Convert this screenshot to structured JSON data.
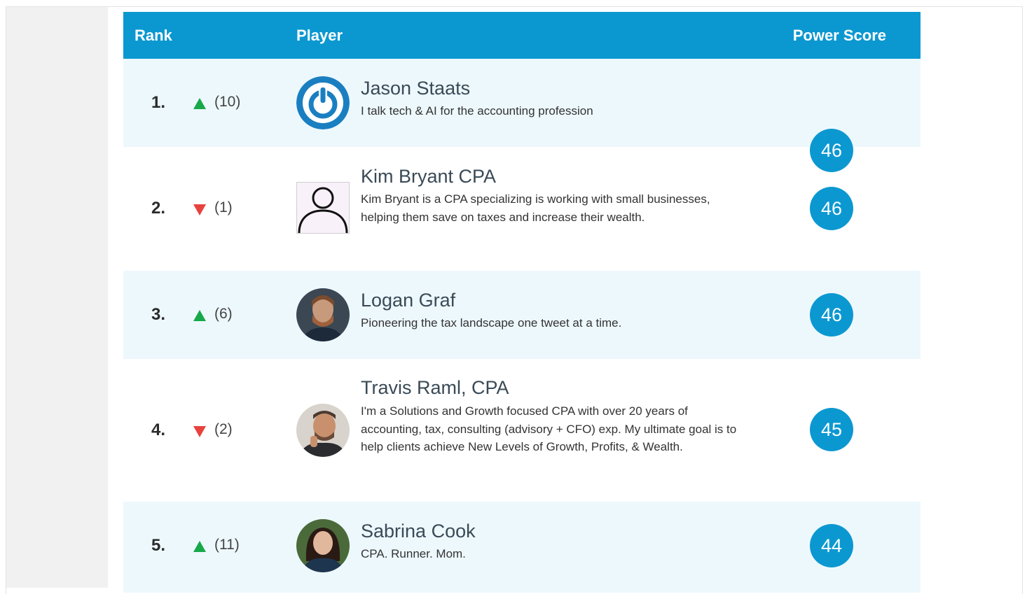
{
  "header": {
    "rank_label": "Rank",
    "player_label": "Player",
    "score_label": "Power Score"
  },
  "players": [
    {
      "rank": "1.",
      "trend": "up",
      "change": "(10)",
      "name": "Jason Staats",
      "bio": "I talk tech & AI for the accounting profession",
      "score": "46",
      "avatar": "power-logo-avatar"
    },
    {
      "rank": "2.",
      "trend": "down",
      "change": "(1)",
      "name": "Kim Bryant CPA",
      "bio": "Kim Bryant is a CPA specializing is working with small businesses, helping them save on taxes and increase their wealth.",
      "score": "46",
      "avatar": "default-person-avatar"
    },
    {
      "rank": "3.",
      "trend": "up",
      "change": "(6)",
      "name": "Logan Graf",
      "bio": "Pioneering the tax landscape one tweet at a time.",
      "score": "46",
      "avatar": "photo-avatar"
    },
    {
      "rank": "4.",
      "trend": "down",
      "change": "(2)",
      "name": "Travis Raml, CPA",
      "bio": "I'm a Solutions and Growth focused CPA with over 20 years of accounting, tax, consulting (advisory + CFO) exp. My ultimate goal is to help clients achieve New Levels of Growth, Profits, & Wealth.",
      "score": "45",
      "avatar": "photo-avatar"
    },
    {
      "rank": "5.",
      "trend": "up",
      "change": "(11)",
      "name": "Sabrina Cook",
      "bio": "CPA. Runner. Mom.",
      "score": "44",
      "avatar": "photo-avatar"
    }
  ],
  "colors": {
    "header_bg": "#0b98d1",
    "row_alt_bg": "#edf8fd",
    "up": "#17a84a",
    "down": "#e8423e"
  }
}
